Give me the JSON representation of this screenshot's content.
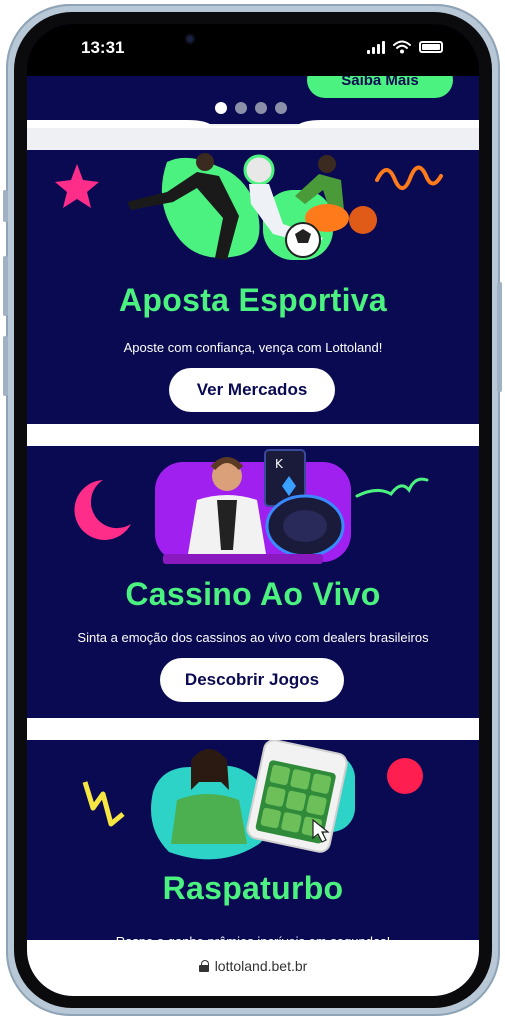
{
  "status_bar": {
    "time": "13:31"
  },
  "hero": {
    "cta_label": "Saiba Mais",
    "carousel": {
      "count": 4,
      "active": 1
    }
  },
  "cards": [
    {
      "title": "Aposta Esportiva",
      "subtitle": "Aposte com confiança, vença com Lottoland!",
      "button": "Ver Mercados"
    },
    {
      "title": "Cassino Ao Vivo",
      "subtitle": "Sinta a emoção dos cassinos ao vivo com dealers brasileiros",
      "button": "Descobrir Jogos"
    },
    {
      "title": "Raspaturbo",
      "subtitle": "Raspe e ganhe prêmios incríveis em segundos!"
    }
  ],
  "browser": {
    "url": "lottoland.bet.br"
  },
  "colors": {
    "navy": "#0a0a52",
    "green": "#4cf27f",
    "pink": "#ff2d8a",
    "yellow": "#f5e642",
    "red": "#ff1e50"
  },
  "icons": [
    "signal-icon",
    "wifi-icon",
    "battery-icon",
    "lock-icon",
    "star-icon",
    "moon-icon",
    "lightning-icon"
  ]
}
